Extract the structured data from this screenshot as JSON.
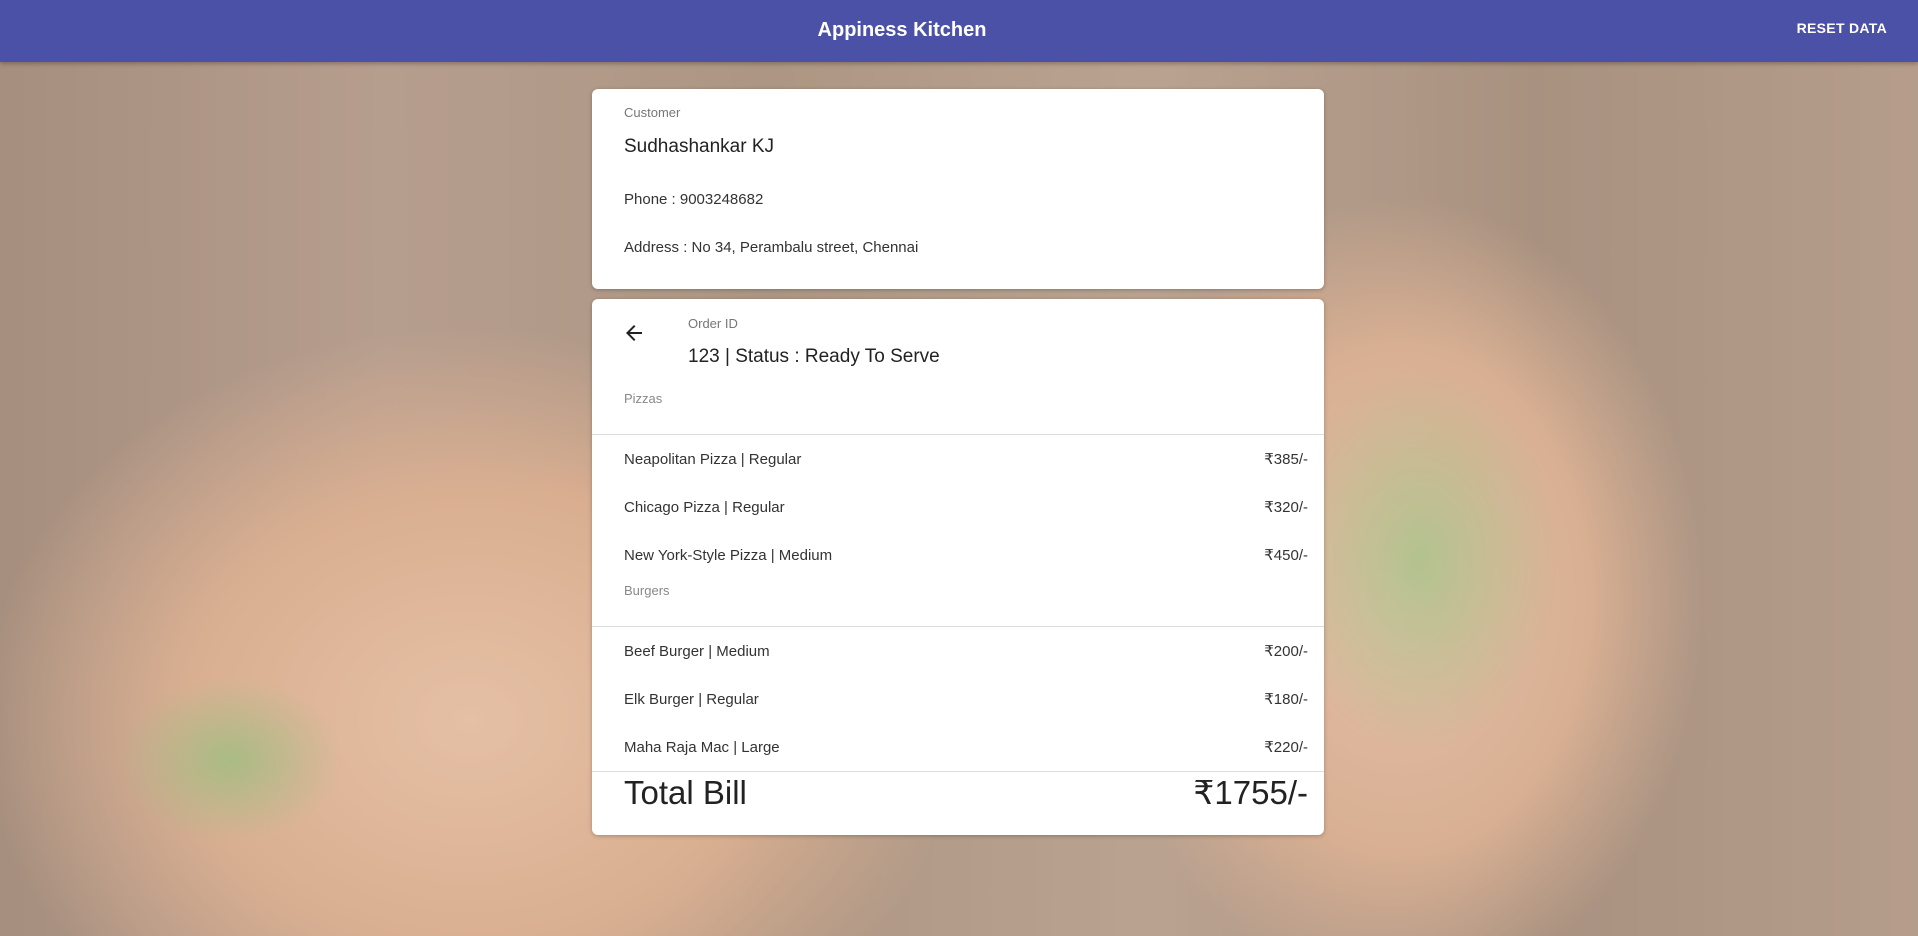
{
  "header": {
    "title": "Appiness Kitchen",
    "reset_label": "RESET DATA"
  },
  "customer": {
    "label": "Customer",
    "name": "Sudhashankar KJ",
    "phone": "Phone : 9003248682",
    "address": "Address : No 34, Perambalu street, Chennai"
  },
  "order": {
    "label": "Order ID",
    "title": "123 | Status : Ready To Serve",
    "sections": [
      {
        "name": "Pizzas",
        "items": [
          {
            "name": "Neapolitan Pizza | Regular",
            "price": "₹385/-"
          },
          {
            "name": "Chicago Pizza | Regular",
            "price": "₹320/-"
          },
          {
            "name": "New York-Style Pizza | Medium",
            "price": "₹450/-"
          }
        ]
      },
      {
        "name": "Burgers",
        "items": [
          {
            "name": "Beef Burger | Medium",
            "price": "₹200/-"
          },
          {
            "name": "Elk Burger | Regular",
            "price": "₹180/-"
          },
          {
            "name": "Maha Raja Mac | Large",
            "price": "₹220/-"
          }
        ]
      }
    ],
    "total_label": "Total Bill",
    "total_value": "₹1755/-"
  },
  "icons": {
    "back": "arrow-left-icon"
  },
  "colors": {
    "appbar": "#4b51a6"
  }
}
